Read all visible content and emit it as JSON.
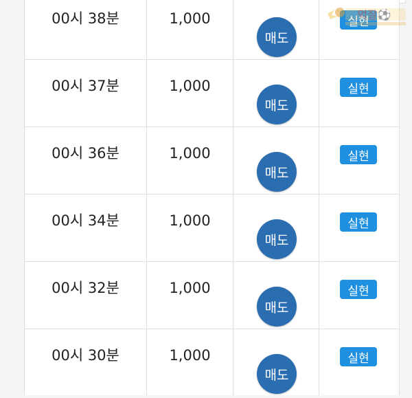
{
  "rows": [
    {
      "time": "00시 38분",
      "amount": "1,000",
      "action": "매도",
      "status": "실현"
    },
    {
      "time": "00시 37분",
      "amount": "1,000",
      "action": "매도",
      "status": "실현"
    },
    {
      "time": "00시 36분",
      "amount": "1,000",
      "action": "매도",
      "status": "실현"
    },
    {
      "time": "00시 34분",
      "amount": "1,000",
      "action": "매도",
      "status": "실현"
    },
    {
      "time": "00시 32분",
      "amount": "1,000",
      "action": "매도",
      "status": "실현"
    },
    {
      "time": "00시 30분",
      "amount": "1,000",
      "action": "매도",
      "status": "실현"
    }
  ],
  "watermark": {
    "text": "먹잘⚽"
  },
  "colors": {
    "sell_button": "#2a6db0",
    "status_badge": "#1f8fe0",
    "border": "#dcdfe4"
  }
}
